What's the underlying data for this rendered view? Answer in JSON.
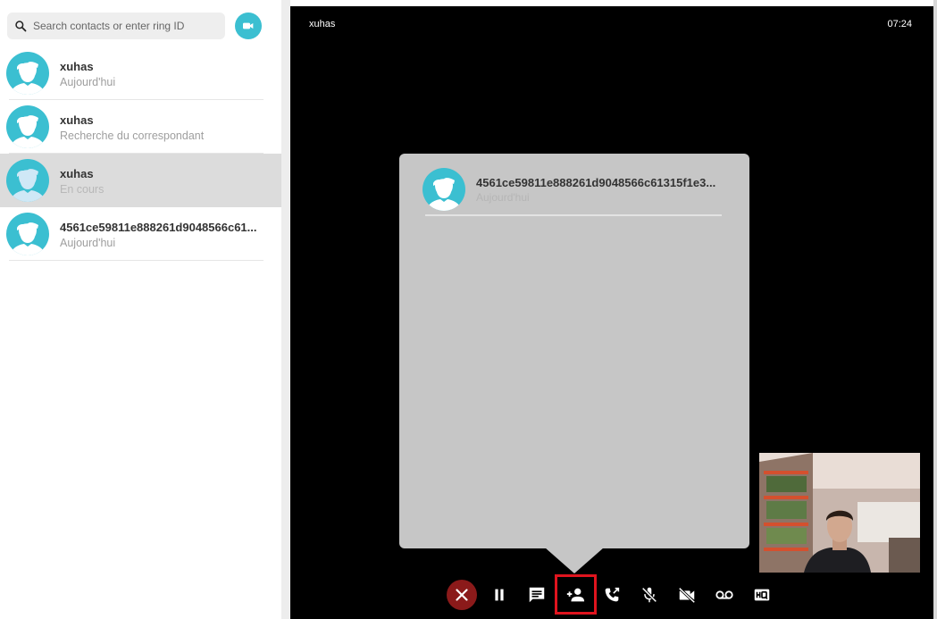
{
  "sidebar": {
    "search": {
      "placeholder": "Search contacts or enter ring ID"
    },
    "contacts": [
      {
        "name": "xuhas",
        "status": "Aujourd'hui",
        "selected": false
      },
      {
        "name": "xuhas",
        "status": "Recherche du correspondant",
        "selected": false
      },
      {
        "name": "xuhas",
        "status": "En cours",
        "selected": true
      },
      {
        "name": "4561ce59811e888261d9048566c61...",
        "status": "Aujourd'hui",
        "selected": false
      }
    ]
  },
  "call": {
    "peer_name": "xuhas",
    "timer": "07:24"
  },
  "popup": {
    "contact": {
      "name": "4561ce59811e888261d9048566c61315f1e3...",
      "status": "Aujourd'hui"
    }
  },
  "colors": {
    "accent": "#3bbfd1",
    "hangup": "#8b1a1a",
    "highlight": "#e0141e",
    "call_background": "#000000",
    "popup_background": "#c6c6c6",
    "selected_row": "#dcdcdc"
  },
  "controls": [
    {
      "icon": "close-icon",
      "action": "hang-up"
    },
    {
      "icon": "pause-icon",
      "action": "hold"
    },
    {
      "icon": "chat-icon",
      "action": "chat"
    },
    {
      "icon": "add-person-icon",
      "action": "add-participant",
      "highlighted": true
    },
    {
      "icon": "call-transfer-icon",
      "action": "transfer"
    },
    {
      "icon": "mic-off-icon",
      "action": "mute"
    },
    {
      "icon": "video-off-icon",
      "action": "video-off"
    },
    {
      "icon": "voicemail-icon",
      "action": "record"
    },
    {
      "icon": "hq-icon",
      "action": "quality"
    }
  ]
}
